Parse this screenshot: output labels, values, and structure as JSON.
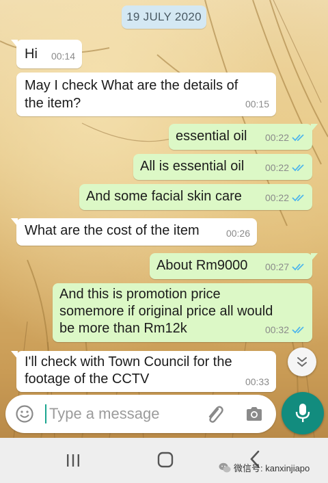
{
  "date_chip": "19 JULY 2020",
  "messages": [
    {
      "dir": "in",
      "lines": [
        "Hi"
      ],
      "time": "00:14"
    },
    {
      "dir": "in",
      "lines": [
        "May I check What are the details of",
        "the item?"
      ],
      "time": "00:15"
    },
    {
      "dir": "out",
      "lines": [
        "essential oil"
      ],
      "time": "00:22",
      "status": "read"
    },
    {
      "dir": "out",
      "lines": [
        "All is essential oil"
      ],
      "time": "00:22",
      "status": "read"
    },
    {
      "dir": "out",
      "lines": [
        "And some facial skin care"
      ],
      "time": "00:22",
      "status": "read"
    },
    {
      "dir": "in",
      "lines": [
        "What are the cost of the item"
      ],
      "time": "00:26"
    },
    {
      "dir": "out",
      "lines": [
        "About Rm9000"
      ],
      "time": "00:27",
      "status": "read"
    },
    {
      "dir": "out",
      "lines": [
        "And this is promotion price",
        "somemore if original price all would",
        "be  more than Rm12k"
      ],
      "time": "00:32",
      "status": "read"
    },
    {
      "dir": "in",
      "lines": [
        "I'll check with Town Council for the",
        "footage of the  CCTV"
      ],
      "time": "00:33"
    }
  ],
  "composer": {
    "placeholder": "Type a message",
    "emoji_icon": "emoji-icon",
    "attach_icon": "paperclip-icon",
    "camera_icon": "camera-icon",
    "mic_icon": "microphone-icon"
  },
  "scroll_down_icon": "double-chevron-down-icon",
  "navbar": {
    "recents_icon": "recent-apps-icon",
    "home_icon": "home-icon",
    "back_icon": "back-icon"
  },
  "watermark": "微信号: kanxinjiapo",
  "colors": {
    "incoming_bubble": "#ffffff",
    "outgoing_bubble": "#dcf8c6",
    "read_tick": "#4fb6ec",
    "accent": "#128c7e",
    "date_chip": "#d4e8f3"
  }
}
